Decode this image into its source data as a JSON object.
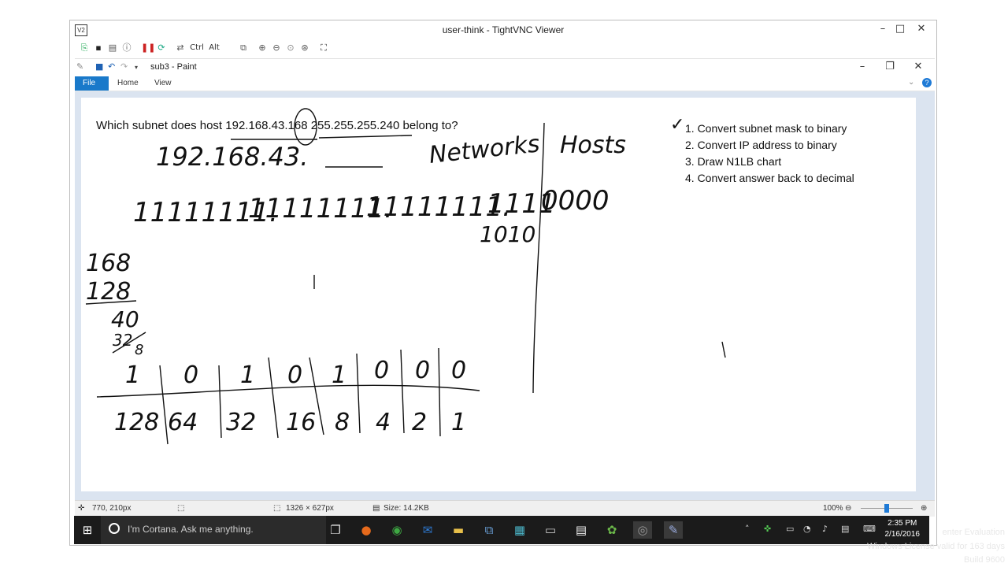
{
  "vnc": {
    "title": "user-think - TightVNC Viewer",
    "toolbar_text": [
      "Ctrl",
      "Alt"
    ]
  },
  "paint": {
    "title": "sub3 - Paint",
    "tabs": [
      "File",
      "Home",
      "View"
    ]
  },
  "canvas": {
    "question_prefix": "Which subnet does host ",
    "ip": "192.168.43.168",
    "mask": "255.255.255.240",
    "question_suffix": " belong to?",
    "steps": [
      "1. Convert subnet mask to binary",
      "2. Convert IP address to binary",
      "3. Draw N1LB chart",
      "4. Convert answer back to decimal"
    ],
    "check": "✓",
    "hw": {
      "ip_partial": "192.168.43.",
      "networks": "Networks",
      "hosts": "Hosts",
      "bits_1": "11111111.",
      "bits_2": "11111111.",
      "bits_3": "11111111.",
      "bits_4a": "1111",
      "bits_4b": "0000",
      "bits_ip": "1010",
      "calc_1": "168",
      "calc_2": "128",
      "calc_3": "40",
      "calc_4": "32",
      "calc_5": "8",
      "chart_bits": [
        "1",
        "0",
        "1",
        "0",
        "1",
        "0",
        "0",
        "0"
      ],
      "chart_vals": [
        "128",
        "64",
        "32",
        "16",
        "8",
        "4",
        "2",
        "1"
      ]
    }
  },
  "status": {
    "cursor": "770, 210px",
    "size": "1326 × 627px",
    "file_size": "Size: 14.2KB",
    "zoom": "100%"
  },
  "taskbar": {
    "search_placeholder": "I'm Cortana. Ask me anything.",
    "time": "2:35 PM",
    "date": "2/16/2016"
  },
  "watermark": {
    "line1": "enter Evaluation",
    "line2": "Windows License valid for 163 days",
    "line3": "Build 9600"
  }
}
